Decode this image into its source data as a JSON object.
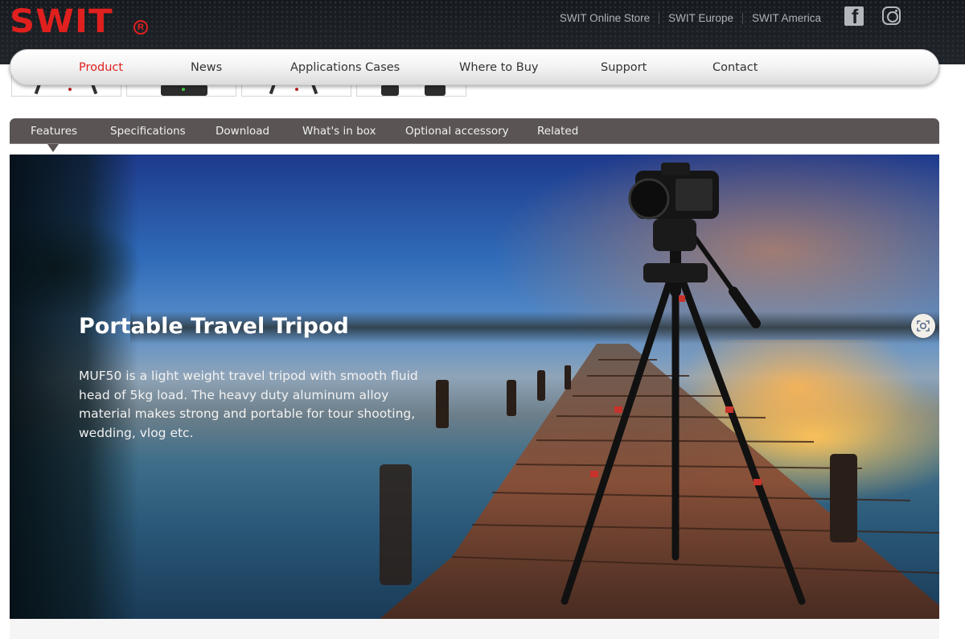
{
  "brand": {
    "logo_text": "SWIT",
    "registered_mark": "R",
    "color": "#e0201e"
  },
  "top_links": [
    {
      "label": "SWIT Online Store"
    },
    {
      "label": "SWIT Europe"
    },
    {
      "label": "SWIT America"
    }
  ],
  "social": {
    "facebook_icon": "facebook-icon",
    "instagram_icon": "instagram-icon"
  },
  "main_nav": {
    "items": [
      {
        "label": "Product",
        "active": true
      },
      {
        "label": "News"
      },
      {
        "label": "Applications Cases"
      },
      {
        "label": "Where to Buy"
      },
      {
        "label": "Support"
      },
      {
        "label": "Contact"
      }
    ],
    "active_color": "#e0201e"
  },
  "sub_tabs": {
    "items": [
      {
        "label": "Features",
        "active": true
      },
      {
        "label": "Specifications"
      },
      {
        "label": "Download"
      },
      {
        "label": "What's in box"
      },
      {
        "label": "Optional accessory"
      },
      {
        "label": "Related"
      }
    ]
  },
  "hero": {
    "title": "Portable Travel Tripod",
    "description": "MUF50 is a light weight travel tripod with smooth fluid head of 5kg load. The heavy duty aluminum alloy material makes strong and portable for tour shooting, wedding, vlog etc.",
    "scan_icon": "visual-search-icon"
  }
}
